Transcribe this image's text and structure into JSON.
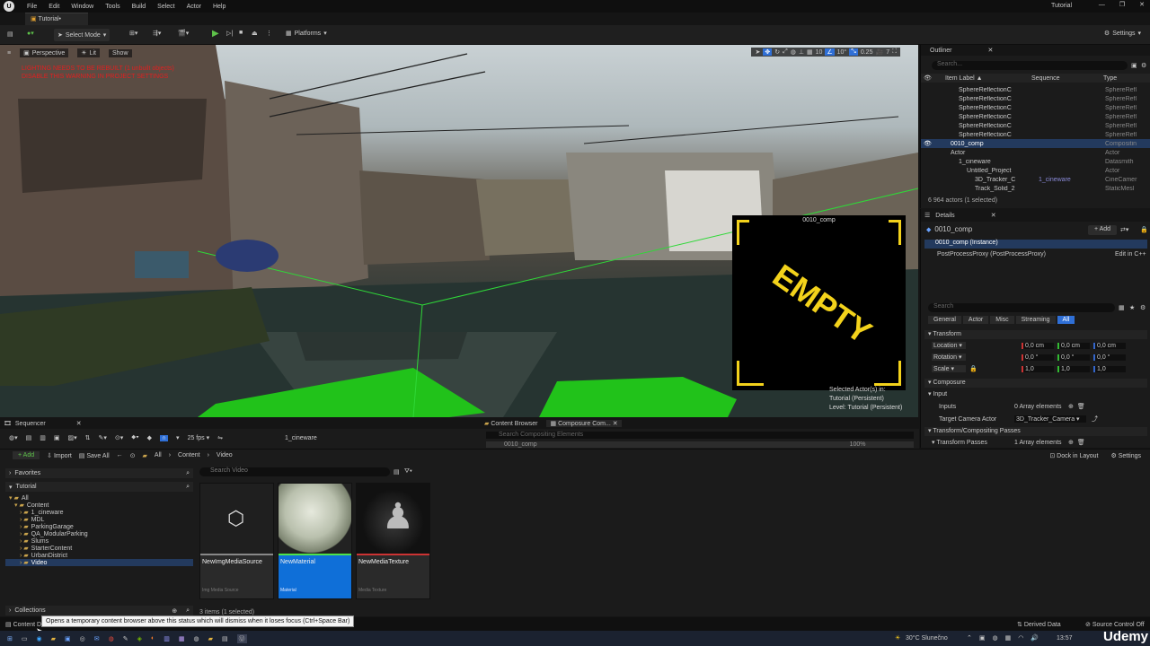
{
  "titlebar": {
    "menus": [
      "File",
      "Edit",
      "Window",
      "Tools",
      "Build",
      "Select",
      "Actor",
      "Help"
    ],
    "project": "Tutorial",
    "tab": "Tutorial•"
  },
  "toolbar": {
    "mode": "Select Mode",
    "platforms": "Platforms",
    "settings": "Settings"
  },
  "viewport": {
    "perspective": "Perspective",
    "lit": "Lit",
    "show": "Show",
    "overlay_text": [
      "LIGHTING NEEDS TO BE REBUILT (1 unbuilt objects)",
      "DISABLE THIS WARNING IN PROJECT SETTINGS"
    ],
    "grid": "10",
    "angle": "10°",
    "scale": "0.25",
    "cam": "7",
    "preview_title": "0010_comp",
    "preview_text": "EMPTY",
    "selected": [
      "Selected Actor(s) in:",
      "Tutorial (Persistent)",
      "Level: Tutorial (Persistent)"
    ]
  },
  "outliner": {
    "title": "Outliner",
    "search": "Search...",
    "cols": [
      "Item Label ▲",
      "Sequence",
      "Type"
    ],
    "rows": [
      {
        "label": "SphereReflectionC",
        "seq": "",
        "type": "SphereRefl",
        "indent": 3,
        "sel": false
      },
      {
        "label": "SphereReflectionC",
        "seq": "",
        "type": "SphereRefl",
        "indent": 3,
        "sel": false
      },
      {
        "label": "SphereReflectionC",
        "seq": "",
        "type": "SphereRefl",
        "indent": 3,
        "sel": false
      },
      {
        "label": "SphereReflectionC",
        "seq": "",
        "type": "SphereRefl",
        "indent": 3,
        "sel": false
      },
      {
        "label": "SphereReflectionC",
        "seq": "",
        "type": "SphereRefl",
        "indent": 3,
        "sel": false
      },
      {
        "label": "SphereReflectionC",
        "seq": "",
        "type": "SphereRefl",
        "indent": 3,
        "sel": false
      },
      {
        "label": "0010_comp",
        "seq": "",
        "type": "Compositin",
        "indent": 2,
        "sel": true
      },
      {
        "label": "Actor",
        "seq": "",
        "type": "Actor",
        "indent": 2,
        "sel": false
      },
      {
        "label": "1_cineware",
        "seq": "",
        "type": "Datasmith",
        "indent": 3,
        "sel": false
      },
      {
        "label": "Untitled_Project",
        "seq": "",
        "type": "Actor",
        "indent": 4,
        "sel": false
      },
      {
        "label": "3D_Tracker_C",
        "seq": "1_cineware",
        "type": "CineCamer",
        "indent": 5,
        "sel": false
      },
      {
        "label": "Track_Solid_2",
        "seq": "",
        "type": "StaticMesl",
        "indent": 5,
        "sel": false
      }
    ],
    "status": "6 964 actors (1 selected)"
  },
  "details": {
    "title": "Details",
    "name": "0010_comp",
    "add": "+ Add",
    "instance": "0010_comp (Instance)",
    "component": "PostProcessProxy (PostProcessProxy)",
    "edit": "Edit in C++",
    "search": "Search",
    "filters": [
      "General",
      "Actor",
      "Misc",
      "Streaming",
      "All"
    ],
    "transform": "Transform",
    "location": {
      "label": "Location",
      "x": "0,0 cm",
      "y": "0,0 cm",
      "z": "0,0 cm"
    },
    "rotation": {
      "label": "Rotation",
      "x": "0,0 °",
      "y": "0,0 °",
      "z": "0,0 °"
    },
    "scale": {
      "label": "Scale",
      "x": "1,0",
      "y": "1,0",
      "z": "1,0"
    },
    "composure": "Composure",
    "input": "Input",
    "inputs": {
      "label": "Inputs",
      "value": "0 Array elements"
    },
    "target": {
      "label": "Target Camera Actor",
      "value": "3D_Tracker_Camera"
    },
    "passes_section": "Transform/Compositing Passes",
    "passes": {
      "label": "Transform Passes",
      "value": "1 Array elements"
    }
  },
  "sequencer": {
    "title": "Sequencer",
    "fps": "25 fps",
    "seq": "1_cineware"
  },
  "tabs2": {
    "content_browser": "Content Browser",
    "composure": "Composure Com...",
    "comp_search": "Search Compositing Elements",
    "comp_row": "0010_comp",
    "zoom": "100%"
  },
  "content": {
    "add": "+ Add",
    "import": "Import",
    "save_all": "Save All",
    "path": [
      "All",
      "Content",
      "Video"
    ],
    "dock": "Dock in Layout",
    "settings": "Settings",
    "search": "Search Video",
    "favorites": "Favorites",
    "tutorial": "Tutorial",
    "tree": [
      {
        "label": "All",
        "indent": 0,
        "sel": false
      },
      {
        "label": "Content",
        "indent": 1,
        "sel": false
      },
      {
        "label": "1_cineware",
        "indent": 2,
        "sel": false
      },
      {
        "label": "MDL",
        "indent": 2,
        "sel": false
      },
      {
        "label": "ParkingGarage",
        "indent": 2,
        "sel": false
      },
      {
        "label": "QA_ModularParking",
        "indent": 2,
        "sel": false
      },
      {
        "label": "Slums",
        "indent": 2,
        "sel": false
      },
      {
        "label": "StarterContent",
        "indent": 2,
        "sel": false
      },
      {
        "label": "UrbanDistrict",
        "indent": 2,
        "sel": false
      },
      {
        "label": "Video",
        "indent": 2,
        "sel": true
      }
    ],
    "assets": [
      {
        "name": "NewImgMediaSource",
        "type": "Img Media Source",
        "sel": false
      },
      {
        "name": "NewMaterial",
        "type": "Material",
        "sel": true
      },
      {
        "name": "NewMediaTexture",
        "type": "Media Texture",
        "sel": false
      }
    ],
    "count": "3 items (1 selected)",
    "collections": "Collections"
  },
  "statusbar": {
    "drawer": "Content Drawer",
    "tooltip": "Opens a temporary content browser above this status which will dismiss when it loses focus (Ctrl+Space Bar)",
    "derived": "Derived Data",
    "source": "Source Control Off"
  },
  "taskbar": {
    "weather": "30°C  Slunečno",
    "time": "13:57",
    "udemy": "Udemy"
  }
}
